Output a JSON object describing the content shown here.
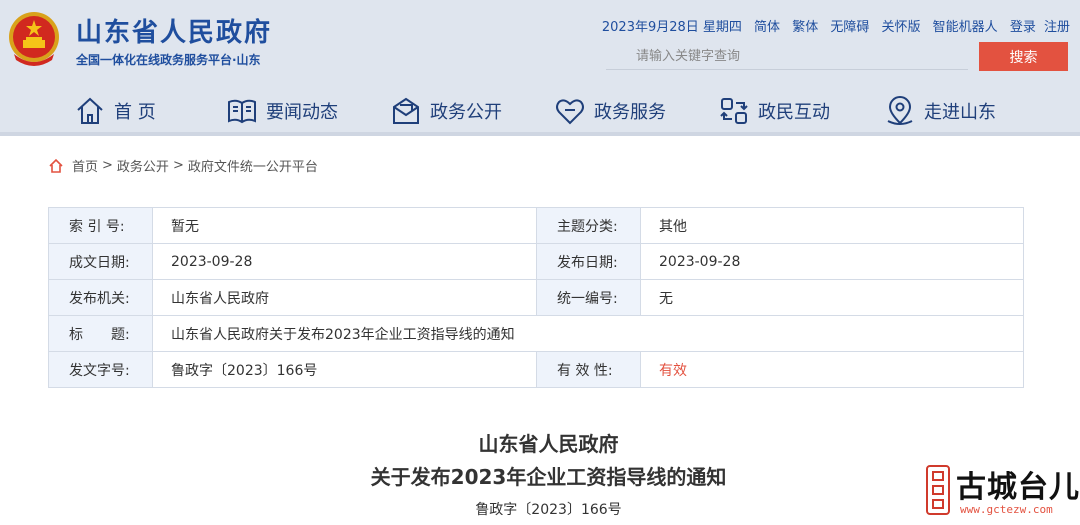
{
  "site": {
    "title": "山东省人民政府",
    "subtitle": "全国一体化在线政务服务平台·山东"
  },
  "toplinks": {
    "date": "2023年9月28日 星期四",
    "items": [
      "简体",
      "繁体",
      "无障碍",
      "关怀版",
      "智能机器人",
      "登录",
      "注册"
    ]
  },
  "search": {
    "placeholder": "请输入关键字查询",
    "button": "搜索"
  },
  "nav": [
    {
      "label": "首 页",
      "icon": "home-icon"
    },
    {
      "label": "要闻动态",
      "icon": "book-icon"
    },
    {
      "label": "政务公开",
      "icon": "mail-icon"
    },
    {
      "label": "政务服务",
      "icon": "heart-icon"
    },
    {
      "label": "政民互动",
      "icon": "exchange-icon"
    },
    {
      "label": "走进山东",
      "icon": "location-icon"
    }
  ],
  "breadcrumb": {
    "items": [
      "首页",
      "政务公开",
      "政府文件统一公开平台"
    ],
    "separator": ">"
  },
  "meta": {
    "index_label": "索 引 号:",
    "index_value": "暂无",
    "topic_label": "主题分类:",
    "topic_value": "其他",
    "written_label": "成文日期:",
    "written_value": "2023-09-28",
    "publish_label": "发布日期:",
    "publish_value": "2023-09-28",
    "org_label": "发布机关:",
    "org_value": "山东省人民政府",
    "code_label": "统一编号:",
    "code_value": "无",
    "title_label": "标　　题:",
    "title_value": "山东省人民政府关于发布2023年企业工资指导线的通知",
    "docno_label": "发文字号:",
    "docno_value": "鲁政字〔2023〕166号",
    "valid_label": "有 效 性:",
    "valid_value": "有效"
  },
  "document": {
    "title_line1": "山东省人民政府",
    "title_line2": "关于发布2023年企业工资指导线的通知",
    "number": "鲁政字〔2023〕166号"
  },
  "watermark": {
    "text": "古城台儿庄",
    "url": "www.gctezw.com"
  },
  "colors": {
    "brand_blue": "#1f4e9e",
    "header_bg": "#dfe5ee",
    "accent_red": "#e35240",
    "table_key_bg": "#eef3fb"
  }
}
